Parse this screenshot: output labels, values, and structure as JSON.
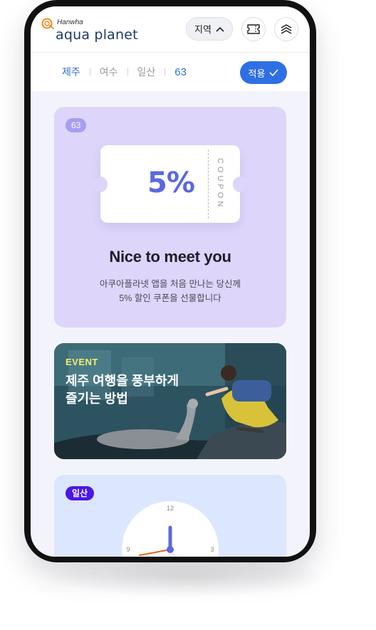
{
  "header": {
    "brand_small": "Hanwha",
    "brand_name": "aqua planet",
    "region_label": "지역"
  },
  "filter": {
    "tabs": [
      {
        "label": "제주",
        "active": true
      },
      {
        "label": "여수",
        "active": false
      },
      {
        "label": "일산",
        "active": false
      },
      {
        "label": "63",
        "active": false
      }
    ],
    "apply_label": "적용"
  },
  "coupon_card": {
    "badge": "63",
    "discount": "5%",
    "ticket_side": "COUPON",
    "title": "Nice to meet you",
    "desc_line1": "아쿠아플라넷 앱을 처음 만나는 당신께",
    "desc_line2": "5% 할인 쿠폰을 선물합니다",
    "bg_color": "#ddd5fa"
  },
  "event_card": {
    "label": "EVENT",
    "title_line1": "제주 여행을 풍부하게",
    "title_line2": "즐기는 방법"
  },
  "clock_card": {
    "badge": "일산",
    "clock_numbers": {
      "top": "12",
      "left": "9",
      "right": "3"
    }
  },
  "colors": {
    "accent": "#2f6fe4",
    "coupon_bg": "#ddd5fa",
    "clock_bg": "#dde6ff",
    "event_label": "#f3ee6a"
  }
}
